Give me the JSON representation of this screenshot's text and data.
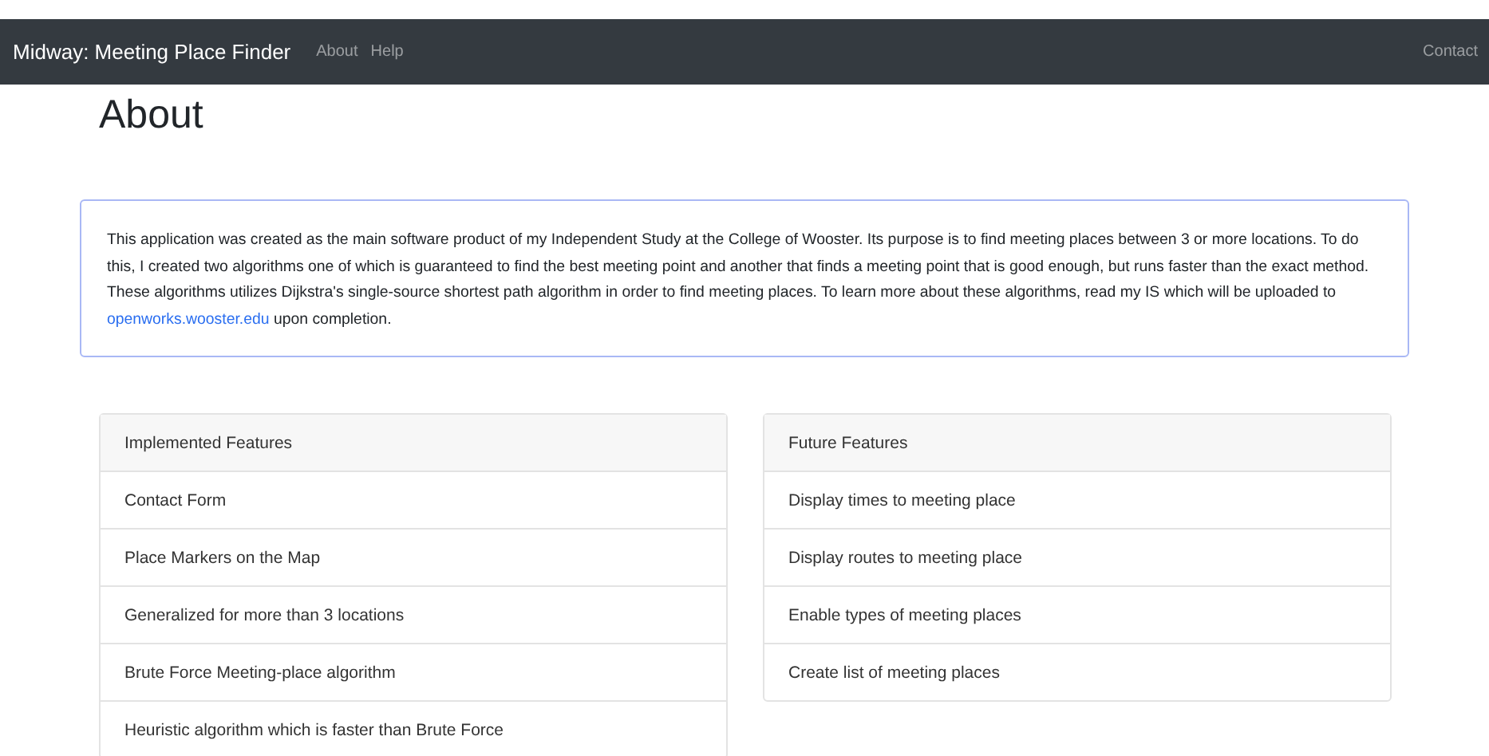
{
  "navbar": {
    "brand": "Midway: Meeting Place Finder",
    "links": [
      "About",
      "Help"
    ],
    "right_link": "Contact"
  },
  "heading": "About",
  "intro": {
    "text_before": "This application was created as the main software product of my Independent Study at the College of Wooster. Its purpose is to find meeting places between 3 or more locations. To do this, I created two algorithms one of which is guaranteed to find the best meeting point and another that finds a meeting point that is good enough, but runs faster than the exact method. These algorithms utilizes Dijkstra's single-source shortest path algorithm in order to find meeting places. To learn more about these algorithms, read my IS which will be uploaded to ",
    "link": "openworks.wooster.edu",
    "text_after": " upon completion."
  },
  "lists": [
    {
      "header": "Implemented Features",
      "items": [
        "Contact Form",
        "Place Markers on the Map",
        "Generalized for more than 3 locations",
        "Brute Force Meeting-place algorithm",
        "Heuristic algorithm which is faster than Brute Force"
      ]
    },
    {
      "header": "Future Features",
      "items": [
        "Display times to meeting place",
        "Display routes to meeting place",
        "Enable types of meeting places",
        "Create list of meeting places"
      ]
    }
  ]
}
